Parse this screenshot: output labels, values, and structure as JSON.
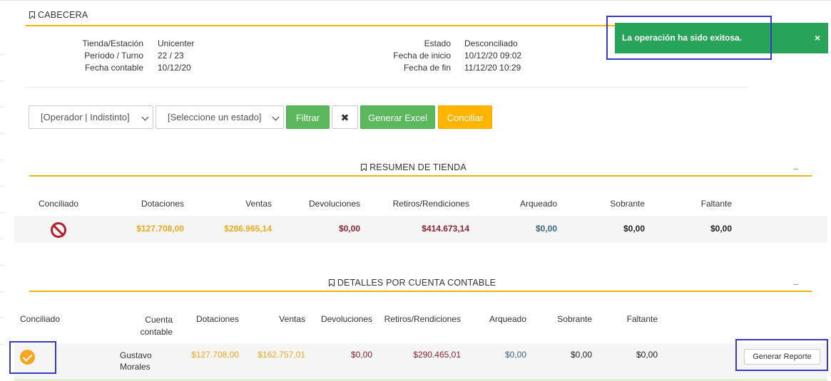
{
  "cabecera": {
    "title": "CABECERA",
    "left": [
      {
        "label": "Tienda/Estación",
        "value": "Unicenter"
      },
      {
        "label": "Período / Turno",
        "value": "22 / 23"
      },
      {
        "label": "Fecha contable",
        "value": "10/12/20"
      }
    ],
    "right": [
      {
        "label": "Estado",
        "value": "Desconciliado"
      },
      {
        "label": "Fecha de inicio",
        "value": "10/12/20 09:02"
      },
      {
        "label": "Fecha de fin",
        "value": "11/12/20 10:29"
      }
    ]
  },
  "filters": {
    "operador_select": "[Operador | Indistinto]",
    "estado_select": "[Seleccione un estado]",
    "filtrar_label": "Filtrar",
    "clear_label": "✖",
    "excel_label": "Generar Excel",
    "conciliar_label": "Conciliar"
  },
  "resumen": {
    "title": "RESUMEN DE TIENDA",
    "headers": [
      "Conciliado",
      "Dotaciones",
      "Ventas",
      "Devoluciones",
      "Retiros/Rendiciones",
      "Arqueado",
      "Sobrante",
      "Faltante"
    ],
    "row": {
      "conciliado_icon": "ban-icon",
      "dotaciones": "$127.708,00",
      "ventas": "$286.965,14",
      "devoluciones": "$0,00",
      "retiros": "$414.673,14",
      "arqueado": "$0,00",
      "sobrante": "$0,00",
      "faltante": "$0,00"
    }
  },
  "detalles": {
    "title": "DETALLES POR CUENTA CONTABLE",
    "headers": {
      "conciliado": "Conciliado",
      "cuenta_line1": "Cuenta",
      "cuenta_line2": "contable",
      "dotaciones": "Dotaciones",
      "ventas": "Ventas",
      "devoluciones": "Devoluciones",
      "retiros": "Retiros/Rendiciones",
      "arqueado": "Arqueado",
      "sobrante": "Sobrante",
      "faltante": "Faltante"
    },
    "row": {
      "conciliado_icon": "check-circle-icon",
      "cuenta_line1": "Gustavo",
      "cuenta_line2": "Morales",
      "dotaciones": "$127.708,00",
      "ventas": "$162.757,01",
      "devoluciones": "$0,00",
      "retiros": "$290.465,01",
      "arqueado": "$0,00",
      "sobrante": "$0,00",
      "faltante": "$0,00",
      "report_button": "Generar Reporte"
    }
  },
  "toast": {
    "message": "La operación ha sido exitosa.",
    "close": "×"
  },
  "colors": {
    "accent": "#f4b400",
    "success": "#27a35a",
    "button_green": "#5cb85c",
    "button_orange": "#ffb400",
    "negative": "#8b2331",
    "neutral_value": "#3d6680"
  }
}
